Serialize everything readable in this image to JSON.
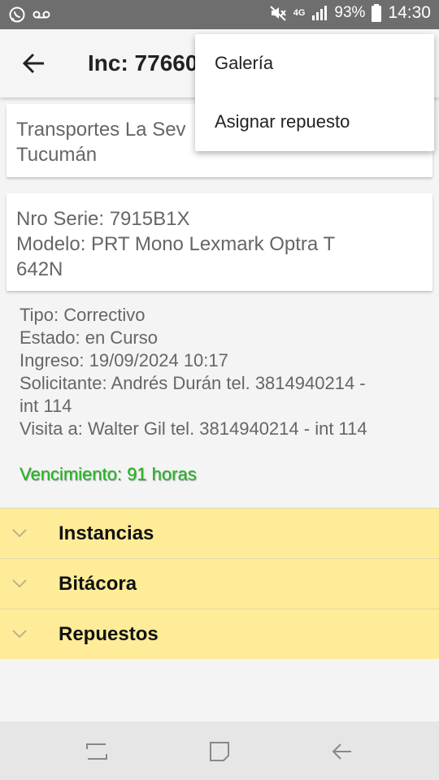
{
  "status_bar": {
    "left_icons": [
      "whatsapp-icon",
      "voicemail-icon"
    ],
    "network": "4G",
    "battery": "93%",
    "time": "14:30"
  },
  "app_bar": {
    "title": "Inc: 77660",
    "back_icon": "back-arrow-icon"
  },
  "client_card": {
    "line1": "Transportes La Sev",
    "line2": "Tucumán"
  },
  "equipment_card": {
    "line1": "Nro Serie: 7915B1X",
    "line2": "Modelo: PRT Mono Lexmark Optra T",
    "line3": "642N"
  },
  "details": {
    "tipo": "Tipo: Correctivo",
    "estado": "Estado: en Curso",
    "ingreso": "Ingreso: 19/09/2024 10:17",
    "solicitante_1": "Solicitante: Andrés Durán tel. 3814940214 -",
    "solicitante_2": "int 114",
    "visita": "Visita a: Walter Gil tel. 3814940214 - int 114",
    "vencimiento": "Vencimiento: 91 horas"
  },
  "sections": [
    {
      "label": "Instancias"
    },
    {
      "label": "Bitácora"
    },
    {
      "label": "Repuestos"
    }
  ],
  "overflow_menu": {
    "items": [
      {
        "label": "Galería"
      },
      {
        "label": "Asignar repuesto"
      }
    ]
  },
  "colors": {
    "section_background": "#ffec99",
    "vencimiento_text": "#1db51d",
    "status_bar": "#6e6e6e"
  }
}
